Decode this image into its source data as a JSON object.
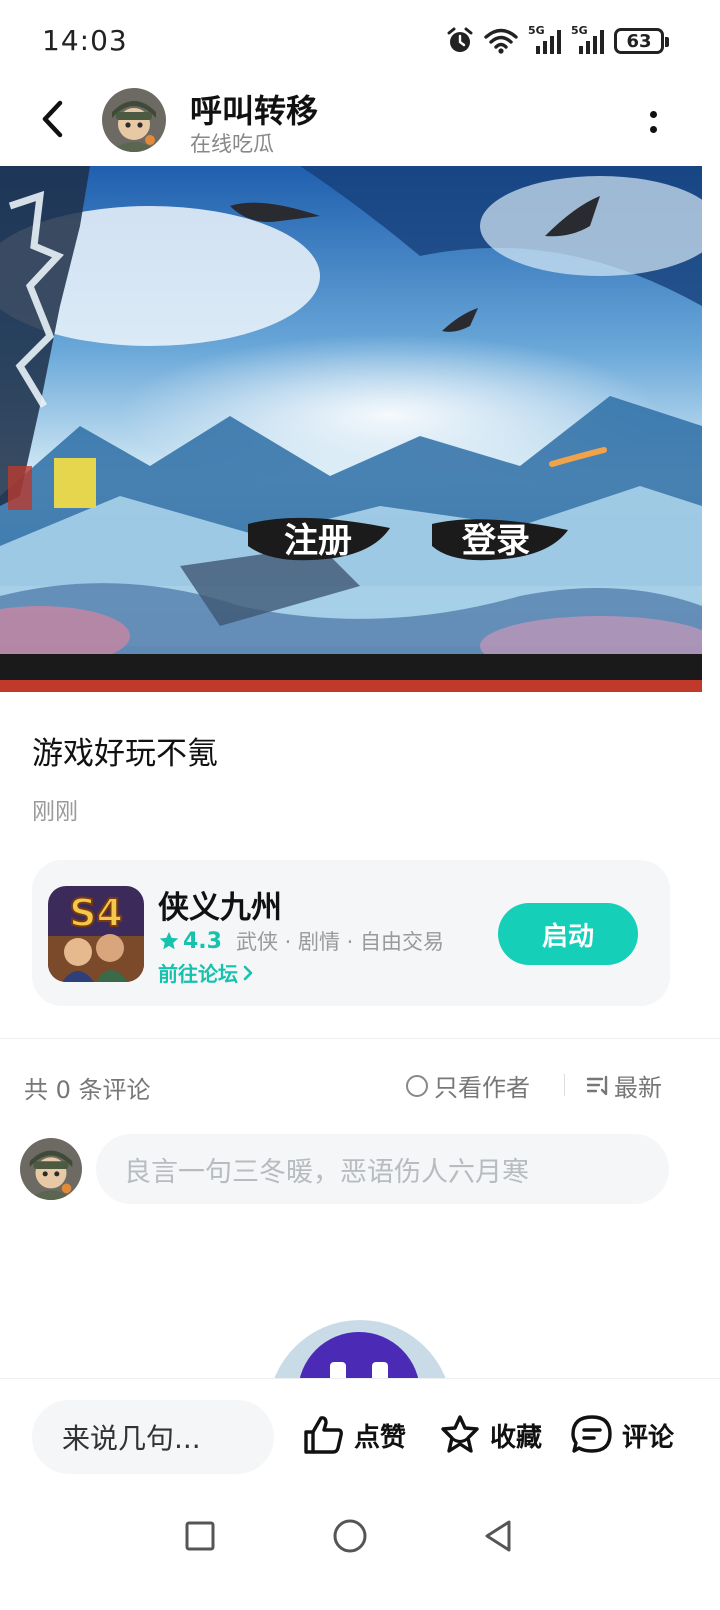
{
  "status_bar": {
    "time": "14:03",
    "net1": "5G",
    "net2": "5G",
    "battery": "63",
    "icons": [
      "alarm-icon",
      "wifi-icon",
      "signal-icon",
      "signal-icon",
      "battery-icon"
    ]
  },
  "header": {
    "user_name": "呼叫转移",
    "user_subtitle": "在线吃瓜"
  },
  "hero": {
    "btn_register": "注册",
    "btn_login": "登录"
  },
  "post": {
    "text": "游戏好玩不氪",
    "time": "刚刚"
  },
  "game_card": {
    "name": "侠义九州",
    "rating": "4.3",
    "tags": "武侠 · 剧情 · 自由交易",
    "forum_link": "前往论坛",
    "launch_label": "启动",
    "accent": "#16cfb9"
  },
  "comments": {
    "count_text": "共 0 条评论",
    "author_only": "只看作者",
    "sort_label": "最新",
    "input_placeholder": "良言一句三冬暖，恶语伤人六月寒"
  },
  "bottom_bar": {
    "reply_placeholder": "来说几句...",
    "like_label": "点赞",
    "favorite_label": "收藏",
    "comment_label": "评论"
  }
}
